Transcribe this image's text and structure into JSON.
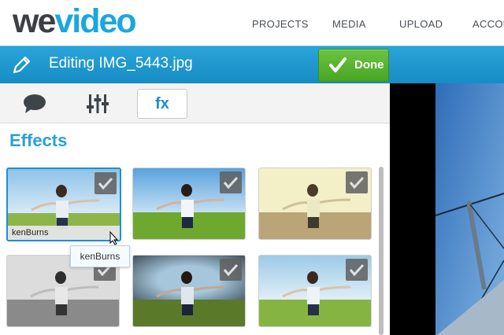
{
  "brand": {
    "logo_we": "we",
    "logo_video": "video"
  },
  "nav": {
    "projects": "PROJECTS",
    "media": "MEDIA",
    "upload": "UPLOAD",
    "account": "ACCOU"
  },
  "editbar": {
    "title": "Editing IMG_5443.jpg",
    "done_label": "Done"
  },
  "toolbar": {
    "fx_label": "fx",
    "tools": [
      "speech-bubble-icon",
      "sliders-icon",
      "fx"
    ]
  },
  "effects": {
    "title": "Effects",
    "thumbnails": [
      {
        "caption": "kenBurns",
        "selected": true,
        "tone": "normal"
      },
      {
        "caption": "",
        "selected": false,
        "tone": "vivid"
      },
      {
        "caption": "",
        "selected": false,
        "tone": "sepia"
      },
      {
        "caption": "",
        "selected": false,
        "tone": "grayscale"
      },
      {
        "caption": "",
        "selected": false,
        "tone": "vignette"
      },
      {
        "caption": "",
        "selected": false,
        "tone": "warm"
      }
    ],
    "tooltip": "kenBurns"
  },
  "colors": {
    "accent": "#1aa7e0",
    "done_green": "#56b02c",
    "bar_blue": "#1f98cf"
  }
}
